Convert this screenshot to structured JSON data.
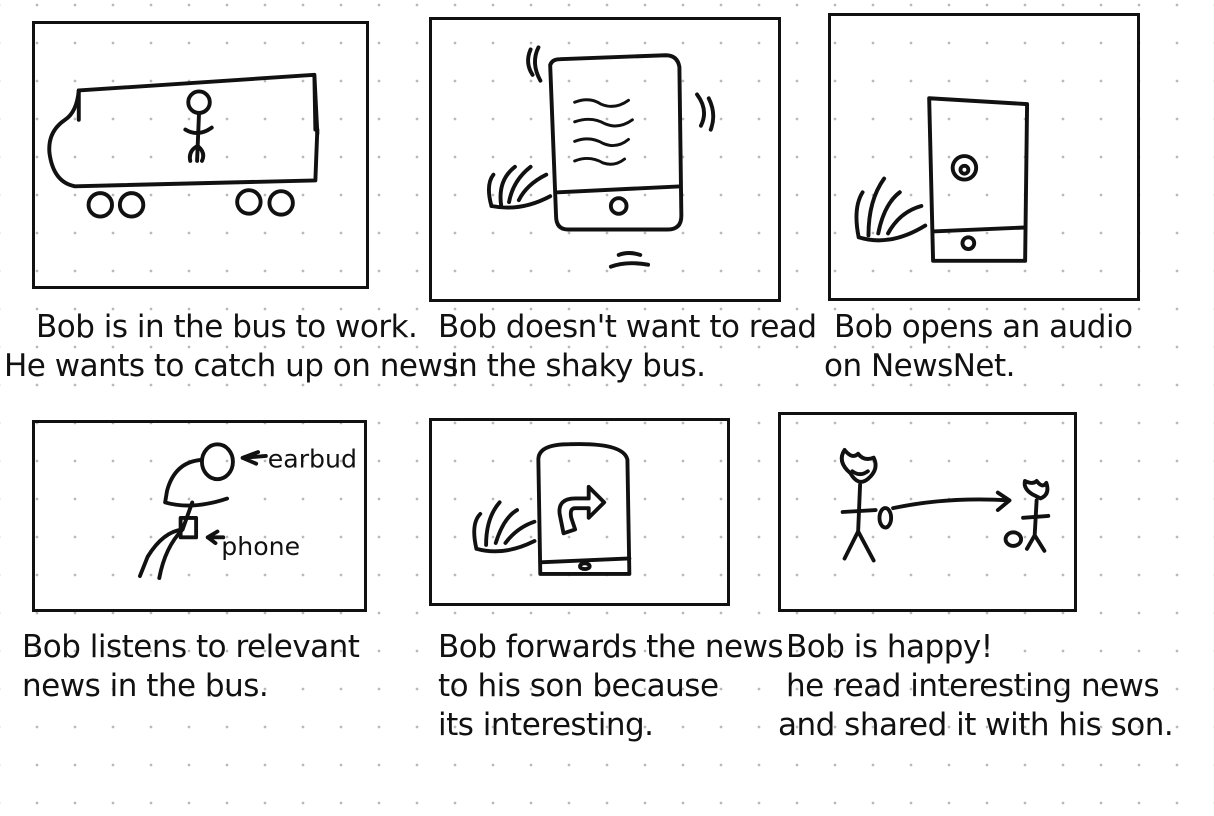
{
  "storyboard": {
    "panels": [
      {
        "scene_icon": "bus-icon",
        "labels": [],
        "caption_lines": [
          "Bob is in the bus to work.",
          "He wants to catch up on news."
        ]
      },
      {
        "scene_icon": "shaky-phone-icon",
        "labels": [],
        "caption_lines": [
          "Bob doesn't want to read",
          "in the shaky bus."
        ]
      },
      {
        "scene_icon": "audio-phone-icon",
        "labels": [],
        "caption_lines": [
          "Bob opens an audio",
          "on NewsNet."
        ]
      },
      {
        "scene_icon": "listening-person-icon",
        "labels": [
          "earbud",
          "phone"
        ],
        "caption_lines": [
          "Bob listens to relevant",
          "news in the bus."
        ]
      },
      {
        "scene_icon": "forward-phone-icon",
        "labels": [],
        "caption_lines": [
          "Bob forwards the news",
          "to his son because",
          "its interesting."
        ]
      },
      {
        "scene_icon": "sharing-people-icon",
        "labels": [],
        "caption_lines": [
          "Bob is happy!",
          "he read interesting news",
          "and shared it with his son."
        ]
      }
    ]
  }
}
